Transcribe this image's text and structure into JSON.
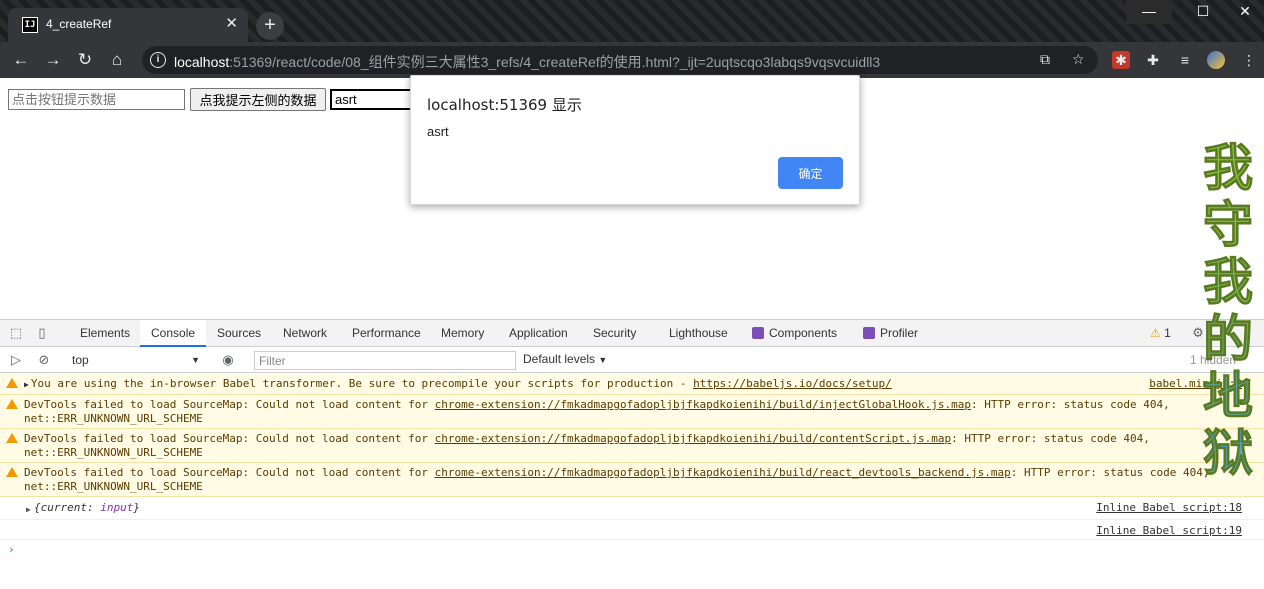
{
  "browser": {
    "tab_title": "4_createRef",
    "tab_favicon": "IJ",
    "url_host": "localhost",
    "url_path": ":51369/react/code/08_组件实例三大属性3_refs/4_createRef的使用.html?_ijt=2uqtscqo3labqs9vqsvcuidll3"
  },
  "page": {
    "input1_placeholder": "点击按钮提示数据",
    "button_label": "点我提示左侧的数据",
    "input2_value": "asrt"
  },
  "dialog": {
    "title": "localhost:51369 显示",
    "message": "asrt",
    "ok_label": "确定"
  },
  "wallpaper_text": [
    "我",
    "守",
    "我",
    "的",
    "地",
    "狱"
  ],
  "devtools": {
    "tabs": [
      "Elements",
      "Console",
      "Sources",
      "Network",
      "Performance",
      "Memory",
      "Application",
      "Security",
      "Lighthouse",
      "Components",
      "Profiler"
    ],
    "active_tab": "Console",
    "warning_count": "1",
    "context": "top",
    "filter_placeholder": "Filter",
    "levels": "Default levels",
    "hidden": "1 hidden"
  },
  "console": {
    "msg1": {
      "text": "You are using the in-browser Babel transformer. Be sure to precompile your scripts for production - ",
      "link": "https://babeljs.io/docs/setup/",
      "source": "babel.min.js:2"
    },
    "msg2": {
      "pre": "DevTools failed to load SourceMap: Could not load content for ",
      "link": "chrome-extension://fmkadmapgofadopljbjfkapdkoienihi/build/injectGlobalHook.js.map",
      "post": ": HTTP error: status code 404,",
      "line2": "net::ERR_UNKNOWN_URL_SCHEME"
    },
    "msg3": {
      "pre": "DevTools failed to load SourceMap: Could not load content for ",
      "link": "chrome-extension://fmkadmapgofadopljbjfkapdkoienihi/build/contentScript.js.map",
      "post": ": HTTP error: status code 404,",
      "line2": "net::ERR_UNKNOWN_URL_SCHEME"
    },
    "msg4": {
      "pre": "DevTools failed to load SourceMap: Could not load content for ",
      "link": "chrome-extension://fmkadmapgofadopljbjfkapdkoienihi/build/react_devtools_backend.js.map",
      "post": ": HTTP error: status code 404,",
      "line2": "net::ERR_UNKNOWN_URL_SCHEME"
    },
    "log1": {
      "open": "{",
      "key": "current: ",
      "value": "input",
      "close": "}",
      "source": "Inline Babel script:18"
    },
    "log2": {
      "source": "Inline Babel script:19"
    },
    "prompt": "›"
  },
  "colors": {
    "accent": "#1a73e8",
    "dialog_button": "#4285f4",
    "warning": "#f29900",
    "wallpaper_top": "#8dc63f",
    "wallpaper_bottom": "#4fa3e0"
  }
}
